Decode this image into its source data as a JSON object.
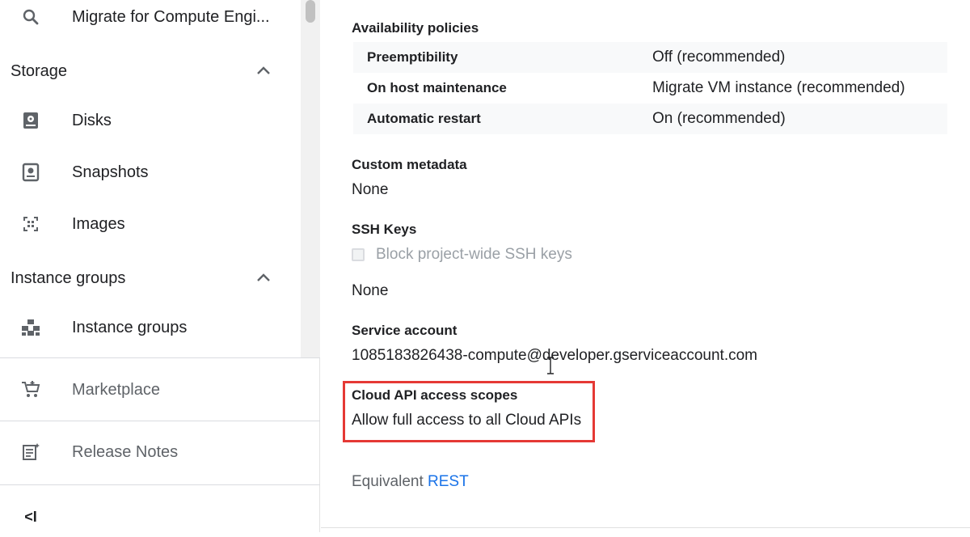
{
  "sidebar": {
    "top_item": {
      "label": "Migrate for Compute Engi...",
      "icon": "search-icon"
    },
    "storage_section": {
      "label": "Storage",
      "expanded": true
    },
    "storage_items": [
      {
        "label": "Disks",
        "icon": "disk-icon"
      },
      {
        "label": "Snapshots",
        "icon": "snapshot-icon"
      },
      {
        "label": "Images",
        "icon": "image-icon"
      }
    ],
    "instance_groups_section": {
      "label": "Instance groups",
      "expanded": true
    },
    "instance_groups_items": [
      {
        "label": "Instance groups",
        "icon": "instance-groups-icon"
      }
    ],
    "marketplace": {
      "label": "Marketplace",
      "icon": "cart-icon"
    },
    "release_notes": {
      "label": "Release Notes",
      "icon": "release-notes-icon"
    },
    "collapse": {
      "label": "<I",
      "icon": "collapse-sidebar-icon"
    }
  },
  "details": {
    "availability_policies": {
      "label": "Availability policies",
      "rows": [
        {
          "key": "Preemptibility",
          "value": "Off (recommended)"
        },
        {
          "key": "On host maintenance",
          "value": "Migrate VM instance (recommended)"
        },
        {
          "key": "Automatic restart",
          "value": "On (recommended)"
        }
      ]
    },
    "custom_metadata": {
      "label": "Custom metadata",
      "value": "None"
    },
    "ssh_keys": {
      "label": "SSH Keys",
      "checkbox_label": "Block project-wide SSH keys",
      "checked": false,
      "value": "None"
    },
    "service_account": {
      "label": "Service account",
      "value": "1085183826438-compute@developer.gserviceaccount.com"
    },
    "cloud_api_scopes": {
      "label": "Cloud API access scopes",
      "value": "Allow full access to all Cloud APIs"
    },
    "equivalent": {
      "prefix": "Equivalent",
      "link": "REST"
    }
  },
  "colors": {
    "highlight": "#e53935",
    "link": "#1a73e8",
    "text": "#202124",
    "muted": "#5f6368"
  }
}
